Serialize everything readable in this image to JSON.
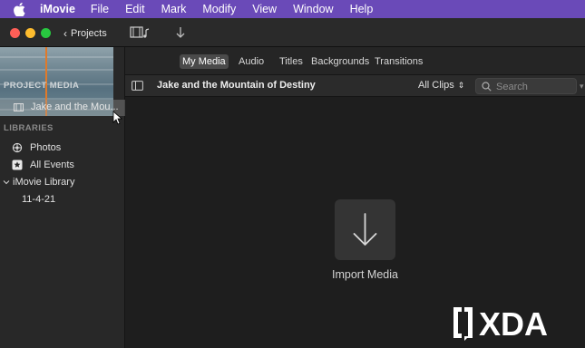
{
  "menubar": {
    "app_name": "iMovie",
    "items": [
      "File",
      "Edit",
      "Mark",
      "Modify",
      "View",
      "Window",
      "Help"
    ]
  },
  "toolbar": {
    "projects_label": "Projects"
  },
  "tabs": [
    "My Media",
    "Audio",
    "Titles",
    "Backgrounds",
    "Transitions"
  ],
  "active_tab": "My Media",
  "sidebar": {
    "project_media_heading": "PROJECT MEDIA",
    "project_item": "Jake and the Mou...",
    "libraries_heading": "LIBRARIES",
    "library_items": [
      {
        "label": "Photos",
        "icon": "flower-icon"
      },
      {
        "label": "All Events",
        "icon": "star-icon"
      },
      {
        "label": "iMovie Library",
        "icon": "chevron-down-icon"
      },
      {
        "label": "11-4-21",
        "icon": ""
      }
    ]
  },
  "browser": {
    "event_title": "Jake and the Mountain of Destiny",
    "clip_filter": "All Clips",
    "search_placeholder": "Search"
  },
  "content": {
    "import_label": "Import Media"
  },
  "watermark": {
    "text": "XDA"
  },
  "colors": {
    "menubar": "#6a4ab8",
    "playhead": "#e07a2a"
  }
}
